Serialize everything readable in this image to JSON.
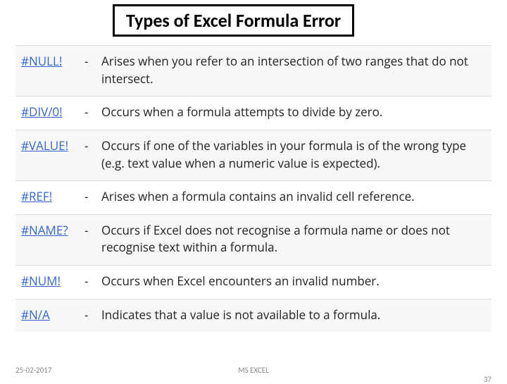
{
  "title": "Types of Excel Formula Error",
  "rows": [
    {
      "code": "#NULL!",
      "desc": "Arises when you refer to an intersection of two ranges that do not intersect."
    },
    {
      "code": "#DIV/0!",
      "desc": "Occurs when a formula attempts to divide by zero."
    },
    {
      "code": "#VALUE!",
      "desc": "Occurs if one of the variables in your formula is of the wrong type (e.g. text value when a numeric value is expected)."
    },
    {
      "code": "#REF!",
      "desc": "Arises when a formula contains an invalid cell reference."
    },
    {
      "code": "#NAME?",
      "desc": "Occurs if Excel does not recognise a formula name or does not recognise text within a formula."
    },
    {
      "code": "#NUM!",
      "desc": "Occurs when Excel encounters an invalid number."
    },
    {
      "code": "#N/A",
      "desc": "Indicates that a value is not available to a formula."
    }
  ],
  "footer": {
    "date": "25-02-2017",
    "center": "MS EXCEL",
    "page": "37"
  },
  "dash": "-"
}
